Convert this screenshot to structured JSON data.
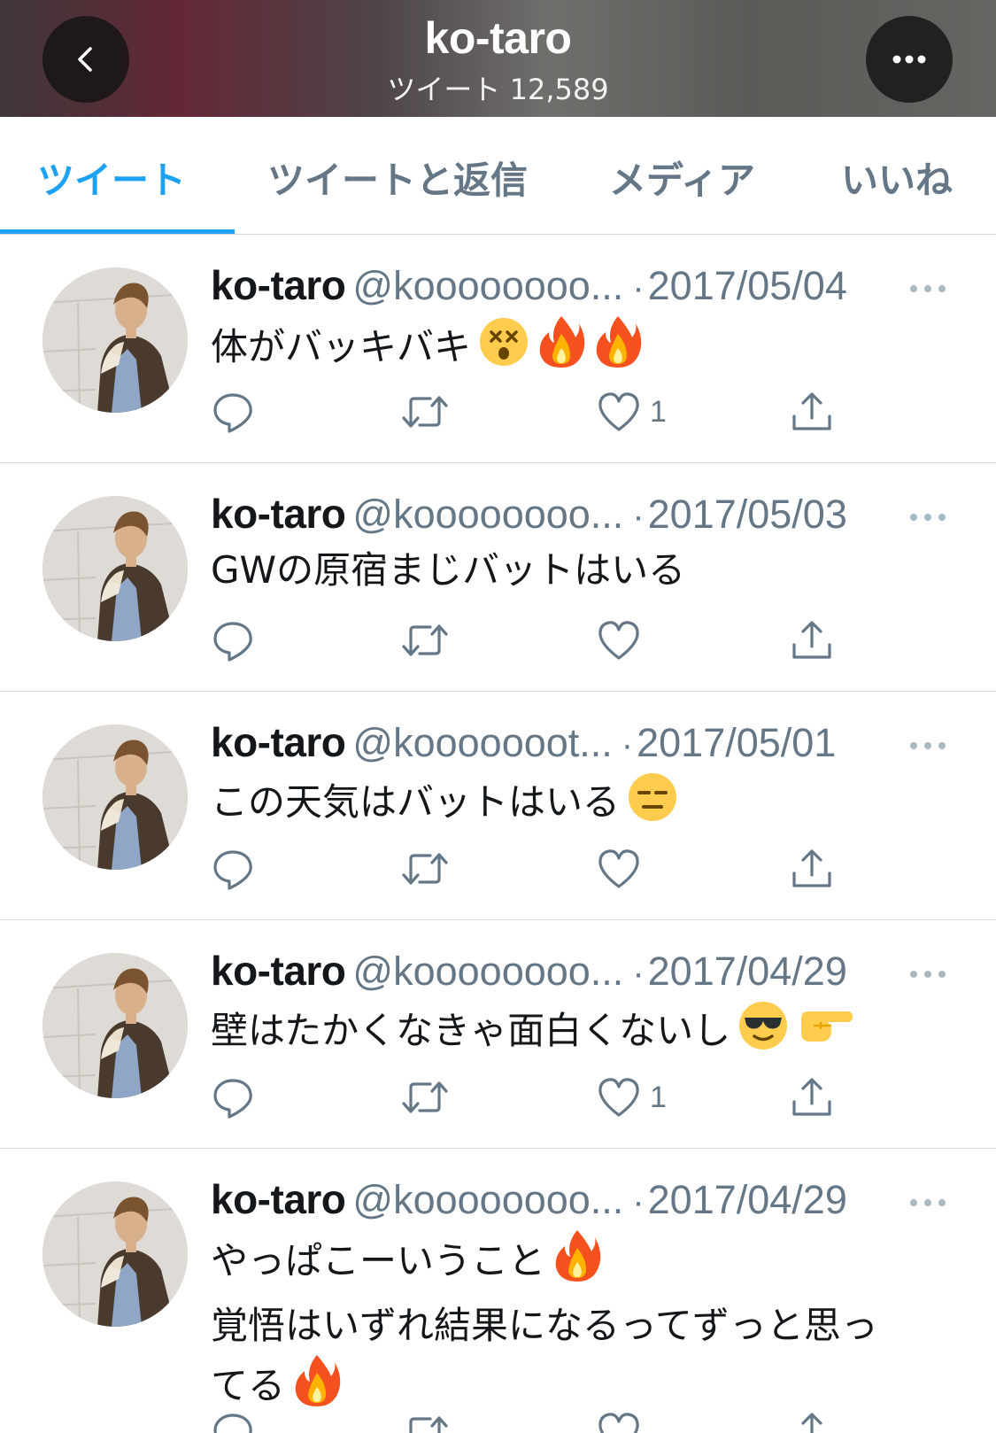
{
  "header": {
    "title": "ko-taro",
    "subtitle": "ツイート 12,589"
  },
  "tabs": [
    {
      "label": "ツイート",
      "active": true
    },
    {
      "label": "ツイートと返信",
      "active": false
    },
    {
      "label": "メディア",
      "active": false
    },
    {
      "label": "いいね",
      "active": false
    }
  ],
  "tweets": [
    {
      "name": "ko-taro",
      "handle": "@koooooooo...",
      "date": "2017/05/04",
      "lines": [
        "体がバッキバキ"
      ],
      "emojis": [
        "dizzy-face-emoji",
        "fire-emoji",
        "fire-emoji"
      ],
      "likes": "1"
    },
    {
      "name": "ko-taro",
      "handle": "@koooooooo...",
      "date": "2017/05/03",
      "lines": [
        "GWの原宿まじバットはいる"
      ],
      "emojis": [],
      "likes": ""
    },
    {
      "name": "ko-taro",
      "handle": "@kooooooot...",
      "date": "2017/05/01",
      "lines": [
        "この天気はバットはいる"
      ],
      "emojis": [
        "expressionless-face-emoji"
      ],
      "likes": ""
    },
    {
      "name": "ko-taro",
      "handle": "@koooooooo...",
      "date": "2017/04/29",
      "lines": [
        "壁はたかくなきゃ面白くないし"
      ],
      "emojis": [
        "sunglasses-face-emoji",
        "pointing-hand-emoji"
      ],
      "likes": "1"
    },
    {
      "name": "ko-taro",
      "handle": "@koooooooo...",
      "date": "2017/04/29",
      "lines": [
        "やっぱこーいうこと",
        "覚悟はいずれ結果になるってずっと思っ",
        "てる"
      ],
      "emojis": [
        "fire-emoji",
        "fire-emoji"
      ],
      "likes": ""
    }
  ],
  "colors": {
    "accent": "#1da1f2",
    "secondary_text": "#657786",
    "primary_text": "#14171a",
    "divider": "#d6dde3"
  },
  "icons": {
    "back": "chevron-left-icon",
    "more": "more-horizontal-icon",
    "reply": "reply-icon",
    "retweet": "retweet-icon",
    "like": "heart-icon",
    "share": "share-icon"
  }
}
